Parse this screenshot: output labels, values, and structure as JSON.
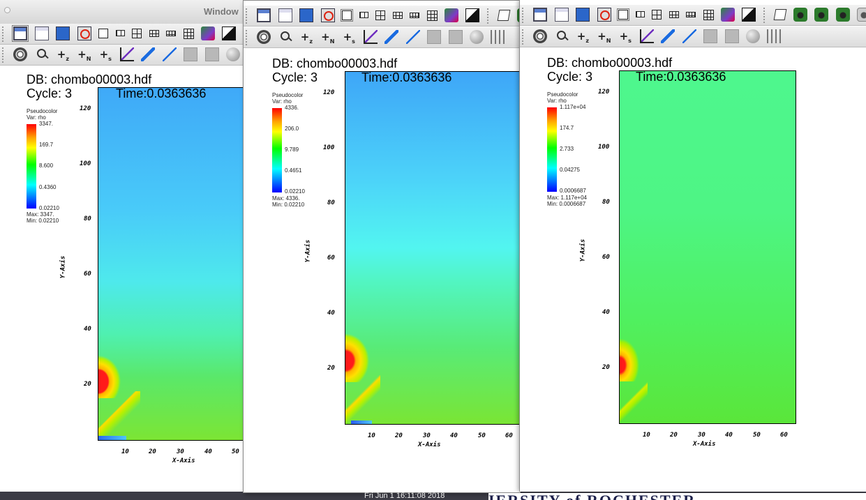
{
  "windows": [
    {
      "window_title": "Window",
      "db": "DB: chombo00003.hdf",
      "cycle": "Cycle: 3",
      "time": "Time:0.0363636",
      "legend": {
        "title": "Pseudocolor",
        "var": "Var: rho",
        "levels": [
          "3347.",
          "169.7",
          "8.600",
          "0.4360",
          "0.02210"
        ],
        "max": "Max:  3347.",
        "min": "Min:  0.02210"
      },
      "y_ticks": [
        "120",
        "100",
        "80",
        "60",
        "40",
        "20"
      ],
      "x_ticks": [
        "10",
        "20",
        "30",
        "40",
        "50"
      ],
      "x_label": "X-Axis",
      "y_label": "Y-Axis"
    },
    {
      "db": "DB: chombo00003.hdf",
      "cycle": "Cycle: 3",
      "time": "Time:0.0363636",
      "legend": {
        "title": "Pseudocolor",
        "var": "Var: rho",
        "levels": [
          "4336.",
          "206.0",
          "9.789",
          "0.4651",
          "0.02210"
        ],
        "max": "Max:  4336.",
        "min": "Min:  0.02210"
      },
      "y_ticks": [
        "120",
        "100",
        "80",
        "60",
        "40",
        "20"
      ],
      "x_ticks": [
        "10",
        "20",
        "30",
        "40",
        "50",
        "60"
      ],
      "x_label": "X-Axis",
      "y_label": "Y-Axis"
    },
    {
      "db": "DB: chombo00003.hdf",
      "cycle": "Cycle: 3",
      "time": "Time:0.0363636",
      "legend": {
        "title": "Pseudocolor",
        "var": "Var: rho",
        "levels": [
          "1.117e+04",
          "174.7",
          "2.733",
          "0.04275",
          "0.0006687"
        ],
        "max": "Max:  1.117e+04",
        "min": "Min:  0.0006687"
      },
      "y_ticks": [
        "120",
        "100",
        "80",
        "60",
        "40",
        "20"
      ],
      "x_ticks": [
        "10",
        "20",
        "30",
        "40",
        "50",
        "60"
      ],
      "x_label": "X-Axis",
      "y_label": "Y-Axis"
    }
  ],
  "toolbar1_icons": [
    "active-window-icon",
    "new-window-icon",
    "copy-window-icon",
    "delete-window-icon",
    "layout-1x1-icon",
    "layout-1x2-icon",
    "layout-2x2-icon",
    "layout-2x3-icon",
    "layout-2x4-icon",
    "layout-3x3-icon",
    "lock-view-icon",
    "invert-background-icon",
    "spin-mode-icon",
    "save-image-icon",
    "camera-icon",
    "camera-icon",
    "camera-gray-icon"
  ],
  "toolbar2_icons": [
    "navigate-icon",
    "zoom-icon",
    "zone-pick-icon",
    "node-pick-icon",
    "spreadsheet-pick-icon",
    "lineout-icon",
    "pick-arrow-icon",
    "line-tool-icon",
    "box-tool-icon",
    "plane-tool-icon",
    "sphere-tool-icon",
    "axis-restrict-icon"
  ],
  "desktop": {
    "clock": "Fri Jun  1 16:11:08 2018",
    "banner": "IERSITY of ROCHESTER"
  }
}
